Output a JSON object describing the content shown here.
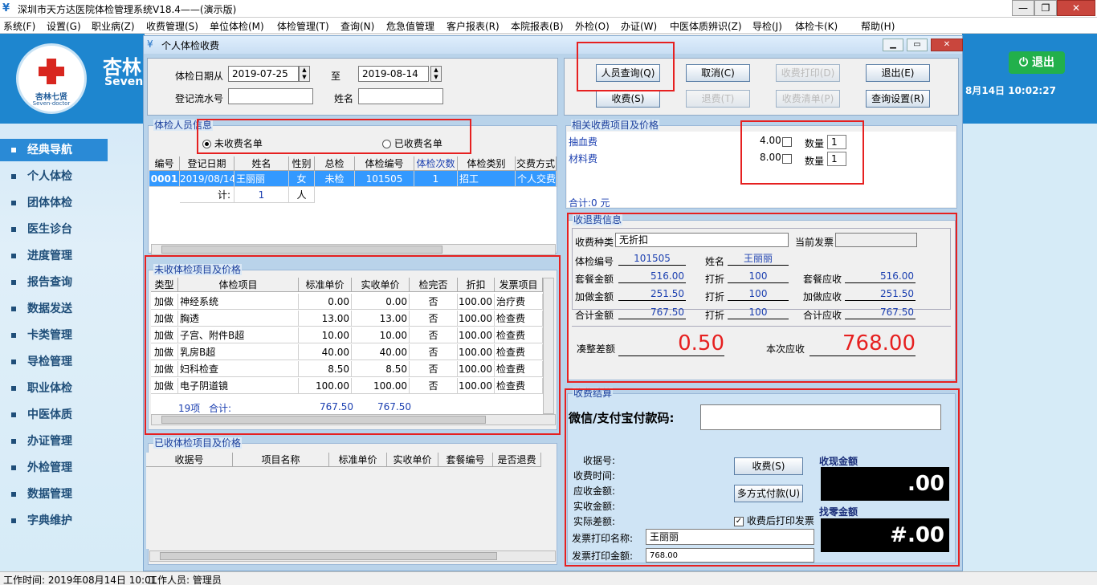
{
  "window": {
    "title": "深圳市天方达医院体检管理系统V18.4——(演示版)",
    "min": "—",
    "max": "❐",
    "close": "✕"
  },
  "menu": [
    "系统(F)",
    "设置(G)",
    "职业病(Z)",
    "收费管理(S)",
    "单位体检(M)",
    "体检管理(T)",
    "查询(N)",
    "危急值管理",
    "客户报表(R)",
    "本院报表(B)",
    "外检(O)",
    "办证(W)",
    "中医体质辨识(Z)",
    "导检(J)",
    "体检卡(K)",
    "帮助(H)"
  ],
  "brand": {
    "logo_text": "杏林七贤",
    "logo_sub": "Seven-doctor",
    "title": "杏林",
    "subtitle": "Seven"
  },
  "nav": [
    "经典导航",
    "个人体检",
    "团体体检",
    "医生诊台",
    "进度管理",
    "报告查询",
    "数据发送",
    "卡类管理",
    "导检管理",
    "职业体检",
    "中医体质",
    "办证管理",
    "外检管理",
    "数据管理",
    "字典维护"
  ],
  "top_right": {
    "logout": "退出",
    "clock": "8月14日  10:02:27"
  },
  "dialog": {
    "title": "个人体检收费",
    "filter": {
      "date_from_label": "体检日期从",
      "date_from": "2019-07-25",
      "to_label": "至",
      "date_to": "2019-08-14",
      "serial_label": "登记流水号",
      "serial": "",
      "name_label": "姓名",
      "name": ""
    },
    "buttons": {
      "query": "人员查询(Q)",
      "cancel": "取消(C)",
      "reprint": "收费打印(D)",
      "exit": "退出(E)",
      "charge": "收费(S)",
      "refund": "退费(T)",
      "clear": "收费清单(P)",
      "settings": "查询设置(R)"
    },
    "people_group": {
      "label": "体检人员信息",
      "radio_unpaid": "未收费名单",
      "radio_paid": "已收费名单"
    },
    "people_table": {
      "headers": [
        "编号",
        "登记日期",
        "姓名",
        "性别",
        "总检",
        "体检编号",
        "体检次数",
        "体检类别",
        "交费方式"
      ],
      "rows": [
        [
          "0001",
          "2019/08/14",
          "王丽丽",
          "女",
          "未检",
          "101505",
          "1",
          "招工",
          "个人交费"
        ]
      ],
      "footer_label": "计:",
      "footer_count": "1",
      "footer_unit": "人"
    },
    "unpaid_group": {
      "label": "未收体检项目及价格",
      "headers": [
        "类型",
        "体检项目",
        "标准单价",
        "实收单价",
        "检完否",
        "折扣",
        "发票项目"
      ],
      "rows": [
        [
          "加做",
          "神经系统",
          "0.00",
          "0.00",
          "否",
          "100.00",
          "治疗费"
        ],
        [
          "加做",
          "胸透",
          "13.00",
          "13.00",
          "否",
          "100.00",
          "检查费"
        ],
        [
          "加做",
          "子宫、附件B超",
          "10.00",
          "10.00",
          "否",
          "100.00",
          "检查费"
        ],
        [
          "加做",
          "乳房B超",
          "40.00",
          "40.00",
          "否",
          "100.00",
          "检查费"
        ],
        [
          "加做",
          "妇科检查",
          "8.50",
          "8.50",
          "否",
          "100.00",
          "检查费"
        ],
        [
          "加做",
          "电子阴道镜",
          "100.00",
          "100.00",
          "否",
          "100.00",
          "检查费"
        ]
      ],
      "footer_count": "19项",
      "footer_label": "合计:",
      "footer_std": "767.50",
      "footer_act": "767.50"
    },
    "paid_group": {
      "label": "已收体检项目及价格",
      "headers": [
        "收据号",
        "项目名称",
        "标准单价",
        "实收单价",
        "套餐编号",
        "是否退费"
      ]
    },
    "related_group": {
      "label": "相关收费项目及价格",
      "items": [
        {
          "name": "抽血费",
          "price": "4.00",
          "qty_label": "数量",
          "qty": "1"
        },
        {
          "name": "材料费",
          "price": "8.00",
          "qty_label": "数量",
          "qty": "1"
        }
      ],
      "total": "合计:0 元"
    },
    "refund_group": {
      "label": "收退费信息",
      "fee_type_label": "收费种类",
      "fee_type": "无折扣",
      "invoice_label": "当前发票",
      "invoice": "",
      "exam_no_label": "体检编号",
      "exam_no": "101505",
      "name_label": "姓名",
      "name": "王丽丽",
      "pkg_amt_label": "套餐金额",
      "pkg_amt": "516.00",
      "discount_label": "打折",
      "pkg_disc": "100",
      "pkg_due_label": "套餐应收",
      "pkg_due": "516.00",
      "add_amt_label": "加做金额",
      "add_amt": "251.50",
      "add_disc": "100",
      "add_due_label": "加做应收",
      "add_due": "251.50",
      "total_amt_label": "合计金额",
      "total_amt": "767.50",
      "total_disc": "100",
      "total_due_label": "合计应收",
      "total_due": "767.50",
      "round_label": "凑整差额",
      "round": "0.50",
      "this_due_label": "本次应收",
      "this_due": "768.00"
    },
    "settle_group": {
      "label": "收费结算",
      "pay_code_label": "微信/支付宝付款码:",
      "pay_code": "",
      "receipt_label": "收据号:",
      "time_label": "收费时间:",
      "due_label": "应收金额:",
      "paid_label": "实收金额:",
      "diff_label": "实际差额:",
      "charge_btn": "收费(S)",
      "multi_btn": "多方式付款(U)",
      "print_after": "收费后打印发票",
      "inv_name_label": "发票打印名称:",
      "inv_name": "王丽丽",
      "inv_amt_label": "发票打印金额:",
      "inv_amt": "768.00",
      "cash_label": "收现金额",
      "cash": ".00",
      "change_label": "找零金额",
      "change": "#.00"
    }
  },
  "status": {
    "time": "工作时间: 2019年08月14日 10:01",
    "user": "工作人员: 管理员"
  }
}
